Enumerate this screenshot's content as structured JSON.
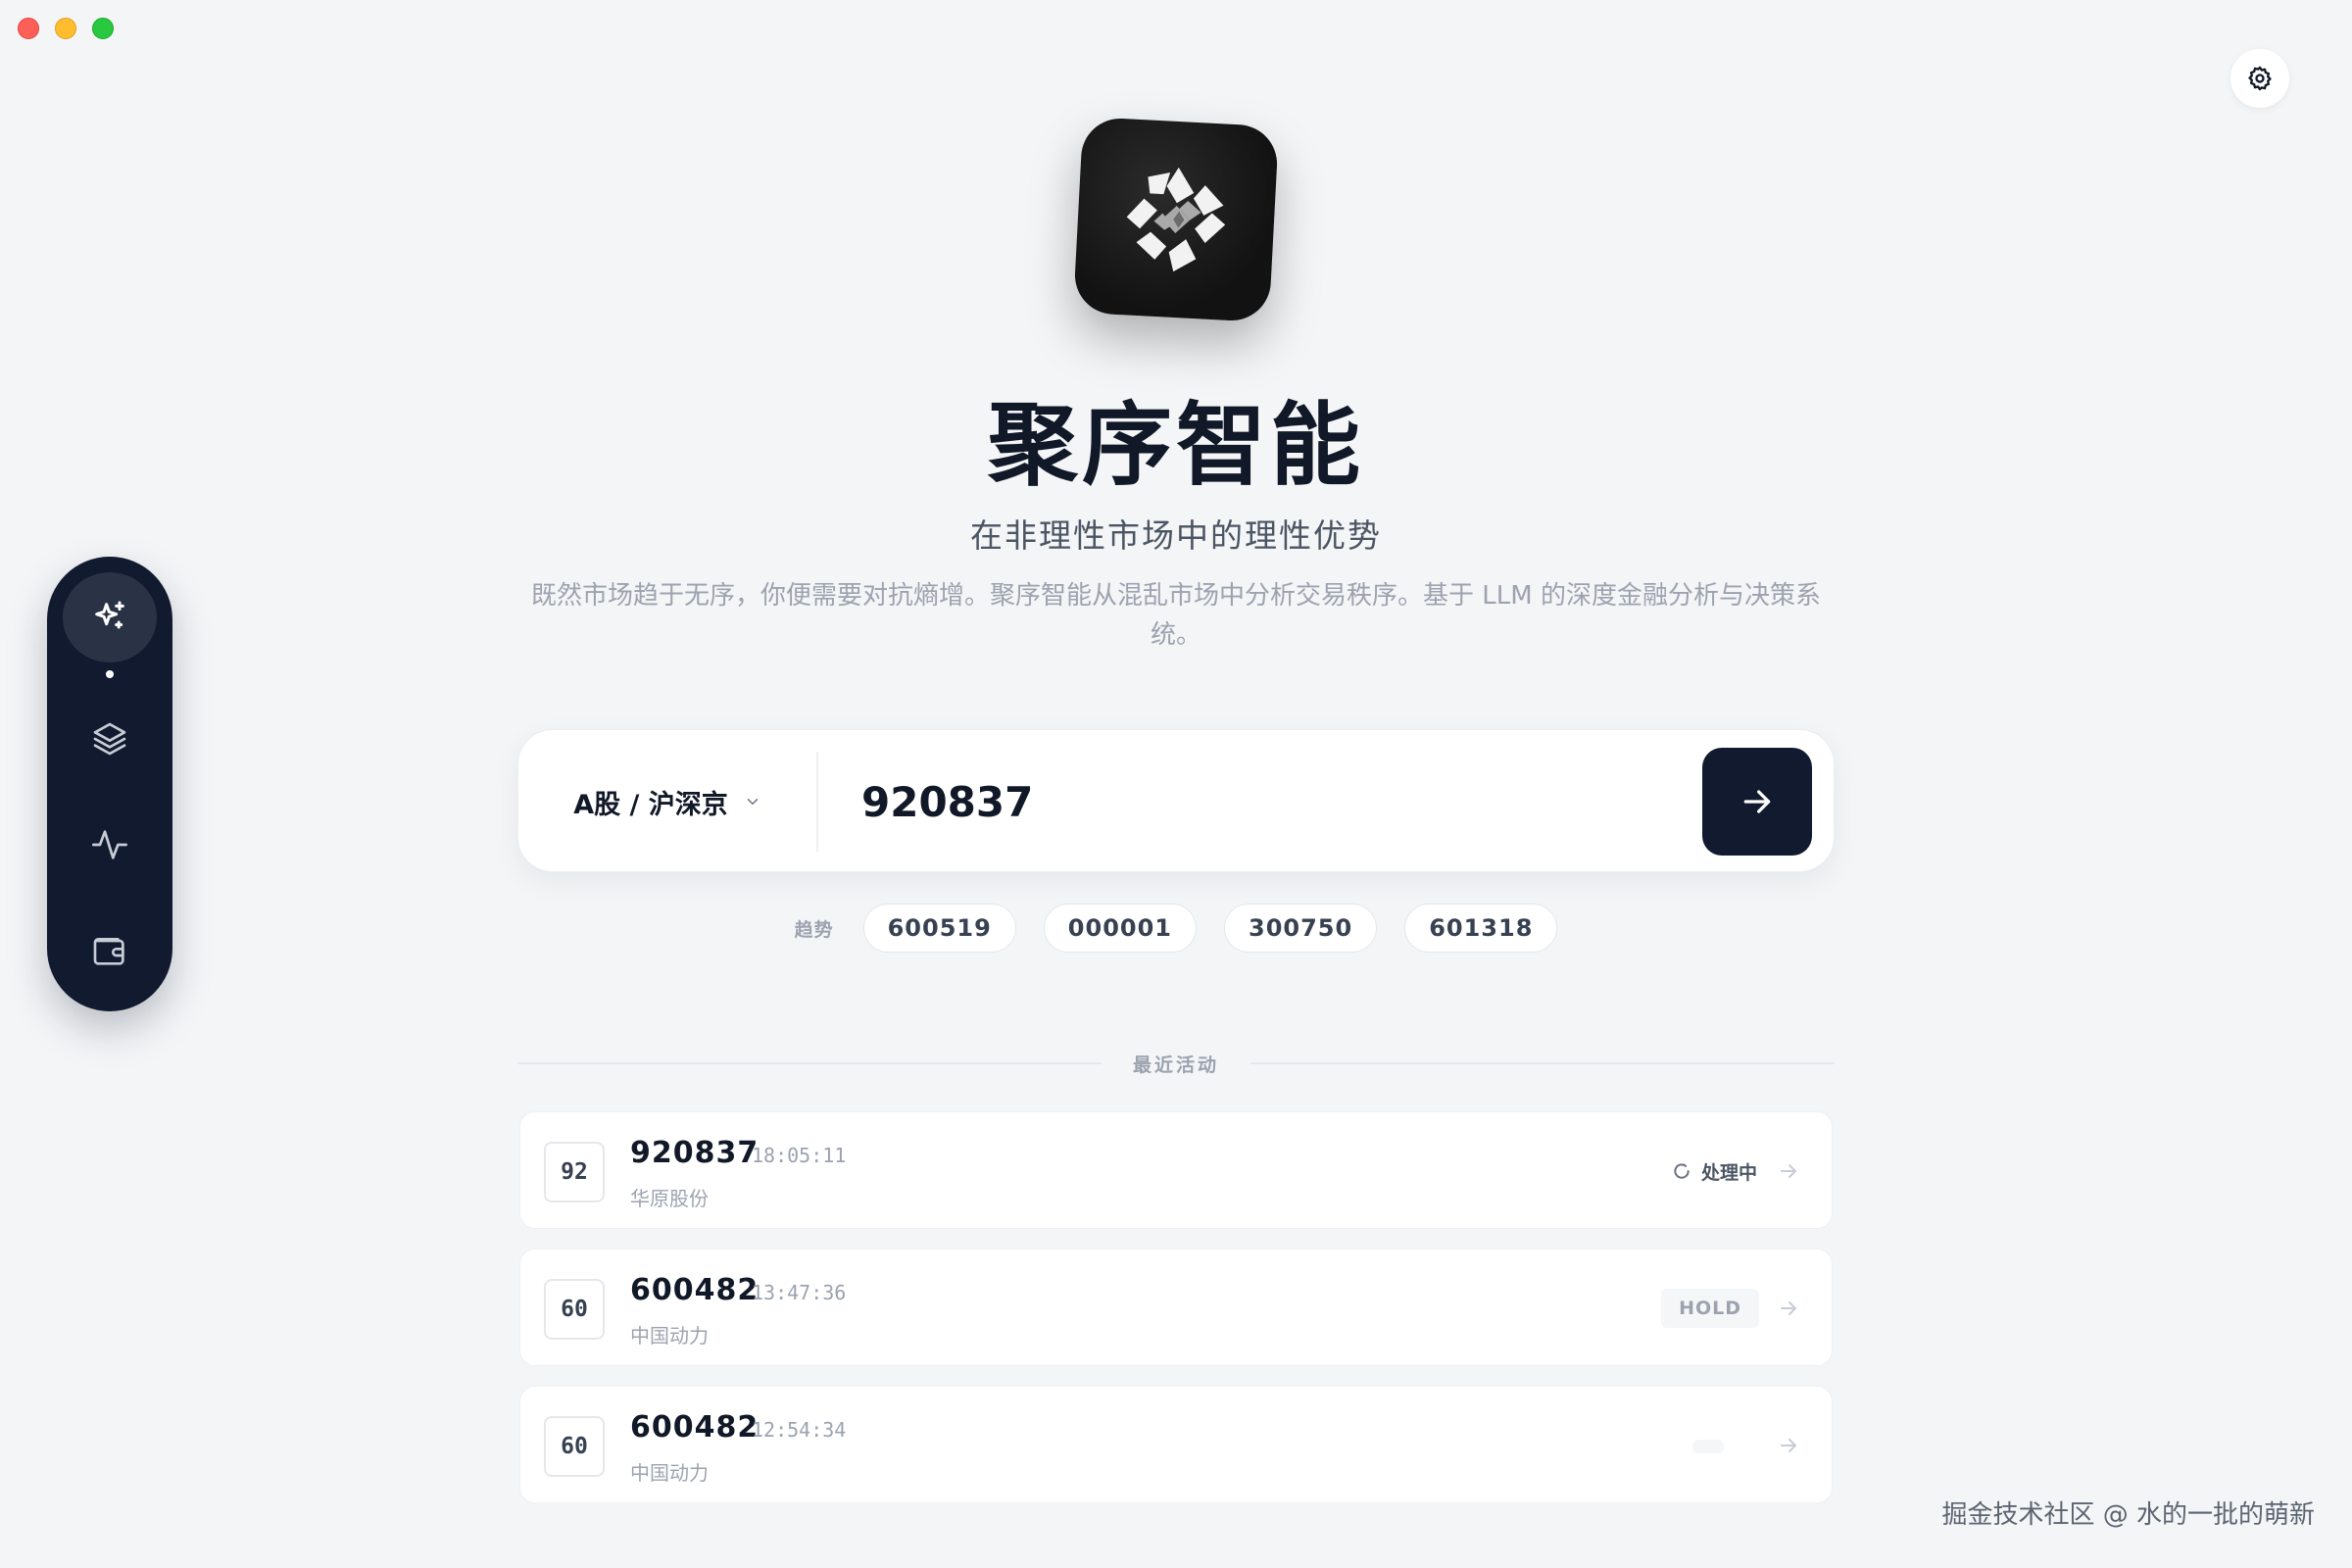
{
  "app": {
    "title": "聚序智能",
    "subtitle": "在非理性市场中的理性优势",
    "description": "既然市场趋于无序，你便需要对抗熵增。聚序智能从混乱市场中分析交易秩序。基于 LLM 的深度金融分析与决策系统。"
  },
  "icons": {
    "settings": "gear-icon",
    "dock": [
      "sparkles-icon",
      "layers-icon",
      "activity-icon",
      "wallet-icon"
    ],
    "submit": "arrow-right-icon",
    "chevron": "chevron-down-icon",
    "loading": "spinner-icon"
  },
  "search": {
    "market": "A股 / 沪深京",
    "value": "920837"
  },
  "trending": {
    "label": "趋势",
    "items": [
      "600519",
      "000001",
      "300750",
      "601318"
    ]
  },
  "recent": {
    "title": "最近活动",
    "items": [
      {
        "badge": "92",
        "code": "920837",
        "time": "18:05:11",
        "name": "华原股份",
        "status": "处理中"
      },
      {
        "badge": "60",
        "code": "600482",
        "time": "13:47:36",
        "name": "中国动力",
        "status": "HOLD"
      },
      {
        "badge": "60",
        "code": "600482",
        "time": "12:54:34",
        "name": "中国动力",
        "status": ""
      }
    ]
  },
  "watermark": "掘金技术社区 @ 水的一批的萌新",
  "colors": {
    "primary": "#111a2e",
    "background": "#f4f5f7",
    "muted": "#9ca3af"
  }
}
